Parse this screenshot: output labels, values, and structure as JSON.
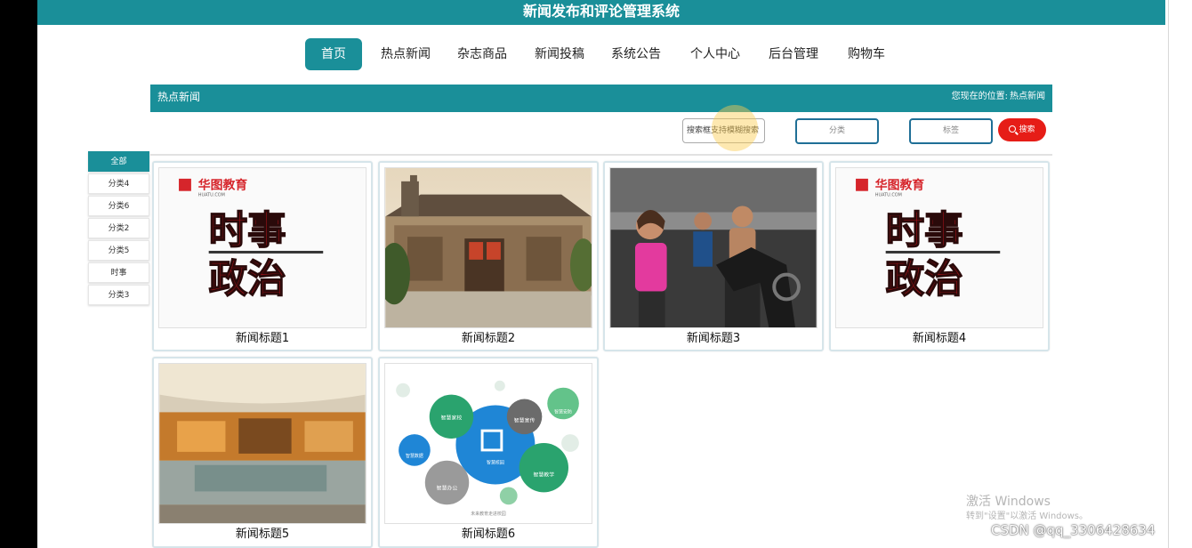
{
  "app_title": "新闻发布和评论管理系统",
  "nav": [
    {
      "label": "首页",
      "active": true
    },
    {
      "label": "热点新闻",
      "active": false
    },
    {
      "label": "杂志商品",
      "active": false
    },
    {
      "label": "新闻投稿",
      "active": false
    },
    {
      "label": "系统公告",
      "active": false
    },
    {
      "label": "个人中心",
      "active": false
    },
    {
      "label": "后台管理",
      "active": false
    },
    {
      "label": "购物车",
      "active": false
    }
  ],
  "section": {
    "title": "热点新闻",
    "breadcrumb_prefix": "您现在的位置:",
    "breadcrumb_current": "热点新闻"
  },
  "search": {
    "placeholder": "搜索框支持模糊搜索",
    "category_label": "分类",
    "tag_label": "标签",
    "button_label": "搜索"
  },
  "categories": [
    {
      "label": "全部",
      "active": true
    },
    {
      "label": "分类4",
      "active": false
    },
    {
      "label": "分类6",
      "active": false
    },
    {
      "label": "分类2",
      "active": false
    },
    {
      "label": "分类5",
      "active": false
    },
    {
      "label": "时事",
      "active": false
    },
    {
      "label": "分类3",
      "active": false
    }
  ],
  "news": [
    {
      "title": "新闻标题1",
      "image": "politics-logo"
    },
    {
      "title": "新闻标题2",
      "image": "old-house-photo"
    },
    {
      "title": "新闻标题3",
      "image": "gym-photo"
    },
    {
      "title": "新闻标题4",
      "image": "politics-logo"
    },
    {
      "title": "新闻标题5",
      "image": "restaurant-photo"
    },
    {
      "title": "新闻标题6",
      "image": "smart-campus-diagram"
    }
  ],
  "poster_text": {
    "brand": "华图教育",
    "brand_url": "HUATU.COM",
    "line1": "时事",
    "line2": "政治"
  },
  "smart_diagram": {
    "bubbles": [
      "智慧家校",
      "智慧宣传",
      "智慧安防",
      "智慧教学",
      "智慧办公",
      "智慧数据",
      "智慧校园"
    ],
    "footer": "未来教育走进校园"
  },
  "os_watermark": {
    "line1": "激活 Windows",
    "line2": "转到\"设置\"以激活 Windows。"
  },
  "csdn_watermark": "CSDN @qq_3306428634",
  "colors": {
    "teal": "#1a8f99",
    "search_red": "#e61d17",
    "filter_border": "#1f6f96"
  }
}
